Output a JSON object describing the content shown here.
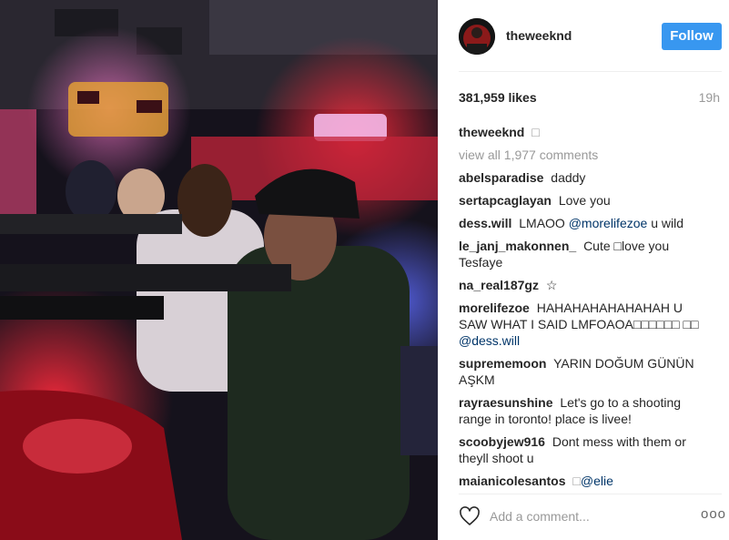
{
  "post": {
    "username": "theweeknd",
    "follow_label": "Follow",
    "likes": "381,959 likes",
    "time_ago": "19h",
    "caption_author": "theweeknd",
    "caption_text": "□",
    "view_all": "view all 1,977 comments",
    "add_comment_placeholder": "Add a comment...",
    "more_label": "ooo"
  },
  "comments": [
    {
      "author": "abelsparadise",
      "text": "daddy",
      "mention": ""
    },
    {
      "author": "sertapcaglayan",
      "text": "Love you",
      "mention": ""
    },
    {
      "author": "dess.will",
      "text": "LMAOO",
      "mention": "@morelifezoe",
      "after": "u wild"
    },
    {
      "author": "le_janj_makonnen_",
      "text": "Cute □love you Tesfaye",
      "mention": ""
    },
    {
      "author": "na_real187gz",
      "text": "☆",
      "mention": ""
    },
    {
      "author": "morelifezoe",
      "text": "HAHAHAHAHAHAHAH U SAW WHAT I SAID LMFOAOA□□□□□□ □□",
      "mention": "@dess.will"
    },
    {
      "author": "suprememoon",
      "text": "YARIN DOĞUM GÜNÜN AŞKM",
      "mention": ""
    },
    {
      "author": "rayraesunshine",
      "text": "Let's go to a shooting range in toronto! place is livee!",
      "mention": ""
    },
    {
      "author": "scoobyjew916",
      "text": "Dont mess with them or theyll shoot u",
      "mention": ""
    },
    {
      "author": "maianicolesantos",
      "text": "□",
      "mention": "@elie"
    }
  ],
  "colors": {
    "follow_blue": "#3897f0",
    "mention": "#003569",
    "muted": "#999999",
    "text": "#262626"
  },
  "icons": {
    "like": "heart-outline-icon",
    "more": "more-options-icon"
  }
}
